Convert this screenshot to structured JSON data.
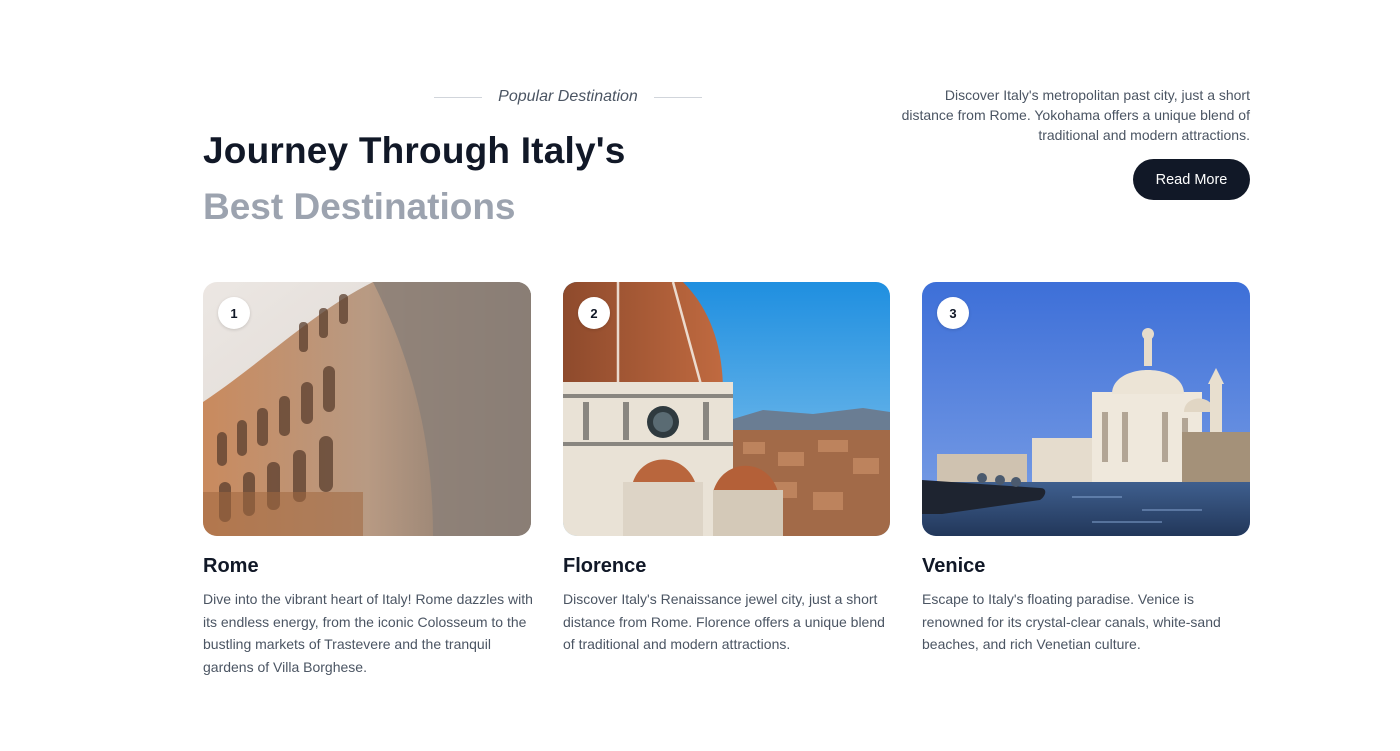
{
  "header": {
    "eyebrow": "Popular Destination",
    "title": "Journey Through Italy's",
    "subtitle": "Best Destinations",
    "intro": "Discover Italy's metropolitan past city, just a short distance from Rome. Yokohama offers a unique blend of traditional and modern attractions.",
    "read_more_label": "Read More"
  },
  "colors": {
    "primary": "#111827",
    "muted": "#9ca3af",
    "body_text": "#4b5563"
  },
  "cards": [
    {
      "number": "1",
      "title": "Rome",
      "description": "Dive into the vibrant heart of Italy! Rome dazzles with its endless energy, from the iconic Colosseum to the bustling markets of Trastevere and the tranquil gardens of Villa Borghese."
    },
    {
      "number": "2",
      "title": "Florence",
      "description": "Discover Italy's Renaissance jewel city, just a short distance from Rome. Florence offers a unique blend of traditional and modern attractions."
    },
    {
      "number": "3",
      "title": "Venice",
      "description": "Escape to Italy's floating paradise. Venice is renowned for its crystal-clear canals, white-sand beaches, and rich Venetian culture."
    }
  ]
}
